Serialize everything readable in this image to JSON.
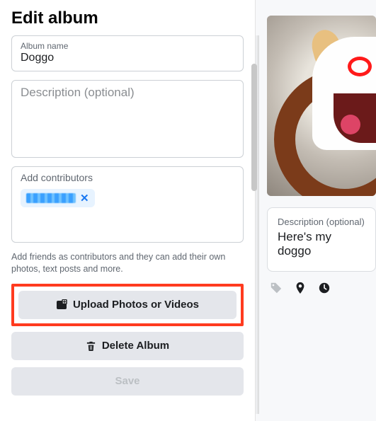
{
  "header": {
    "title": "Edit album"
  },
  "album_name": {
    "label": "Album name",
    "value": "Doggo"
  },
  "description": {
    "placeholder": "Description (optional)",
    "value": ""
  },
  "contributors": {
    "label": "Add contributors",
    "chip_name": "[redacted]"
  },
  "help_text": "Add friends as contributors and they can add their own photos, text posts and more.",
  "buttons": {
    "upload": "Upload Photos or Videos",
    "delete": "Delete Album",
    "save": "Save"
  },
  "preview": {
    "caption_label": "Description (optional)",
    "caption_value": "Here's my doggo"
  }
}
